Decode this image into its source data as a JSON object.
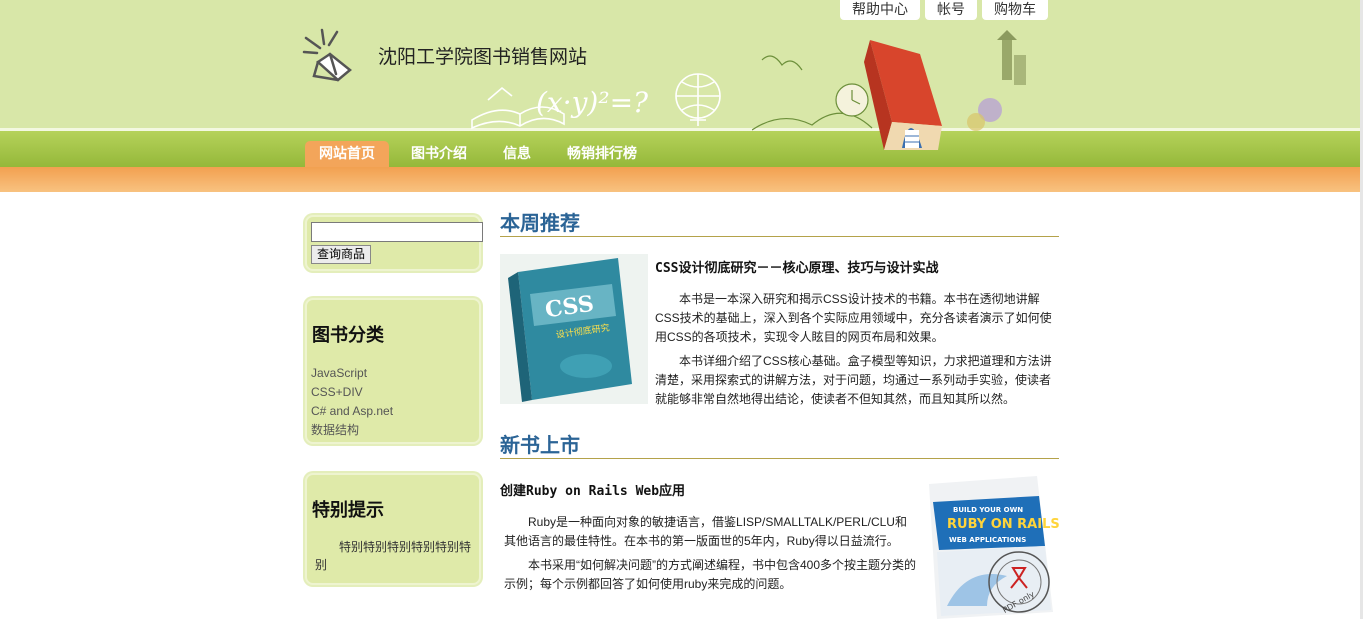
{
  "top_links": [
    "帮助中心",
    "帐号",
    "购物车"
  ],
  "site_title": "沈阳工学院图书销售网站",
  "formula_text": "(x·y)²=?",
  "nav": [
    "网站首页",
    "图书介绍",
    "信息",
    "畅销排行榜"
  ],
  "search": {
    "button": "查询商品",
    "value": ""
  },
  "categories": {
    "title": "图书分类",
    "items": [
      "JavaScript",
      "CSS+DIV",
      "C# and Asp.net",
      "数据结构"
    ]
  },
  "tips": {
    "title": "特别提示",
    "text": "特别特别特别特别特别特别"
  },
  "weekly": {
    "heading": "本周推荐",
    "book_title": "CSS设计彻底研究－－核心原理、技巧与设计实战",
    "cover_text": "CSS",
    "cover_subtitle": "设计彻底研究",
    "para1": "本书是一本深入研究和揭示CSS设计技术的书籍。本书在透彻地讲解CSS技术的基础上，深入到各个实际应用领域中，充分各读者演示了如何使用CSS的各项技术，实现令人眩目的网页布局和效果。",
    "para2": "本书详细介绍了CSS核心基础。盒子模型等知识，力求把道理和方法讲清楚，采用探索式的讲解方法，对于问题，均通过一系列动手实验，使读者就能够非常自然地得出结论，使读者不但知其然，而且知其所以然。"
  },
  "new_books": {
    "heading": "新书上市",
    "book_title": "创建Ruby on Rails Web应用",
    "cover_text1": "BUILD YOUR OWN",
    "cover_text2": "RUBY ON RAILS",
    "cover_text3": "WEB APPLICATIONS",
    "stamp_text": "PDF only",
    "para1": "Ruby是一种面向对象的敏捷语言，借鉴LISP/SMALLTALK/PERL/CLU和其他语言的最佳特性。在本书的第一版面世的5年内，Ruby得以日益流行。",
    "para2": "本书采用“如何解决问题”的方式阐述编程，书中包含400多个按主题分类的示例；每个示例都回答了如何使用ruby来完成的问题。"
  }
}
